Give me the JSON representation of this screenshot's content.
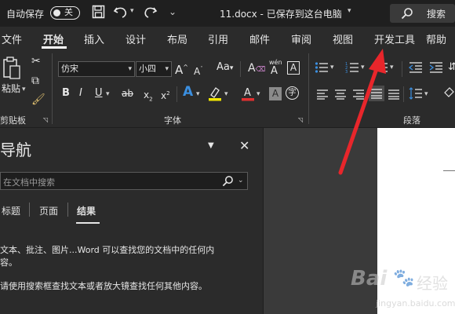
{
  "titlebar": {
    "autosave_label": "自动保存",
    "toggle_label": "关",
    "doc_title": "11.docx - 已保存到这台电脑",
    "search_label": "搜索"
  },
  "tabs": [
    "文件",
    "开始",
    "插入",
    "设计",
    "布局",
    "引用",
    "邮件",
    "审阅",
    "视图",
    "开发工具",
    "帮助"
  ],
  "ribbon": {
    "clipboard": {
      "paste_label": "粘贴",
      "group_label": "剪贴板"
    },
    "font": {
      "font_name": "仿宋",
      "font_size": "小四",
      "group_label": "字体",
      "phonetic_glyph": "wén",
      "char_a": "A",
      "case_label": "Aa"
    },
    "paragraph": {
      "group_label": "段落"
    }
  },
  "nav": {
    "title": "导航",
    "search_placeholder": "在文档中搜索",
    "tabs": [
      "标题",
      "页面",
      "结果"
    ],
    "message_line1": "文本、批注、图片...Word 可以查找您的文档中的任何内",
    "message_line2": "容。",
    "message_line3": "请使用搜索框查找文本或者放大镜查找任何其他内容。"
  },
  "watermark": {
    "brand": "Bai",
    "brand2": "经验",
    "url": "jingyan.baidu.com"
  },
  "colors": {
    "arrow": "#e8262b",
    "highlight": "#f2e600",
    "font_color": "#e03030",
    "text_effect": "#3b8fe0"
  }
}
